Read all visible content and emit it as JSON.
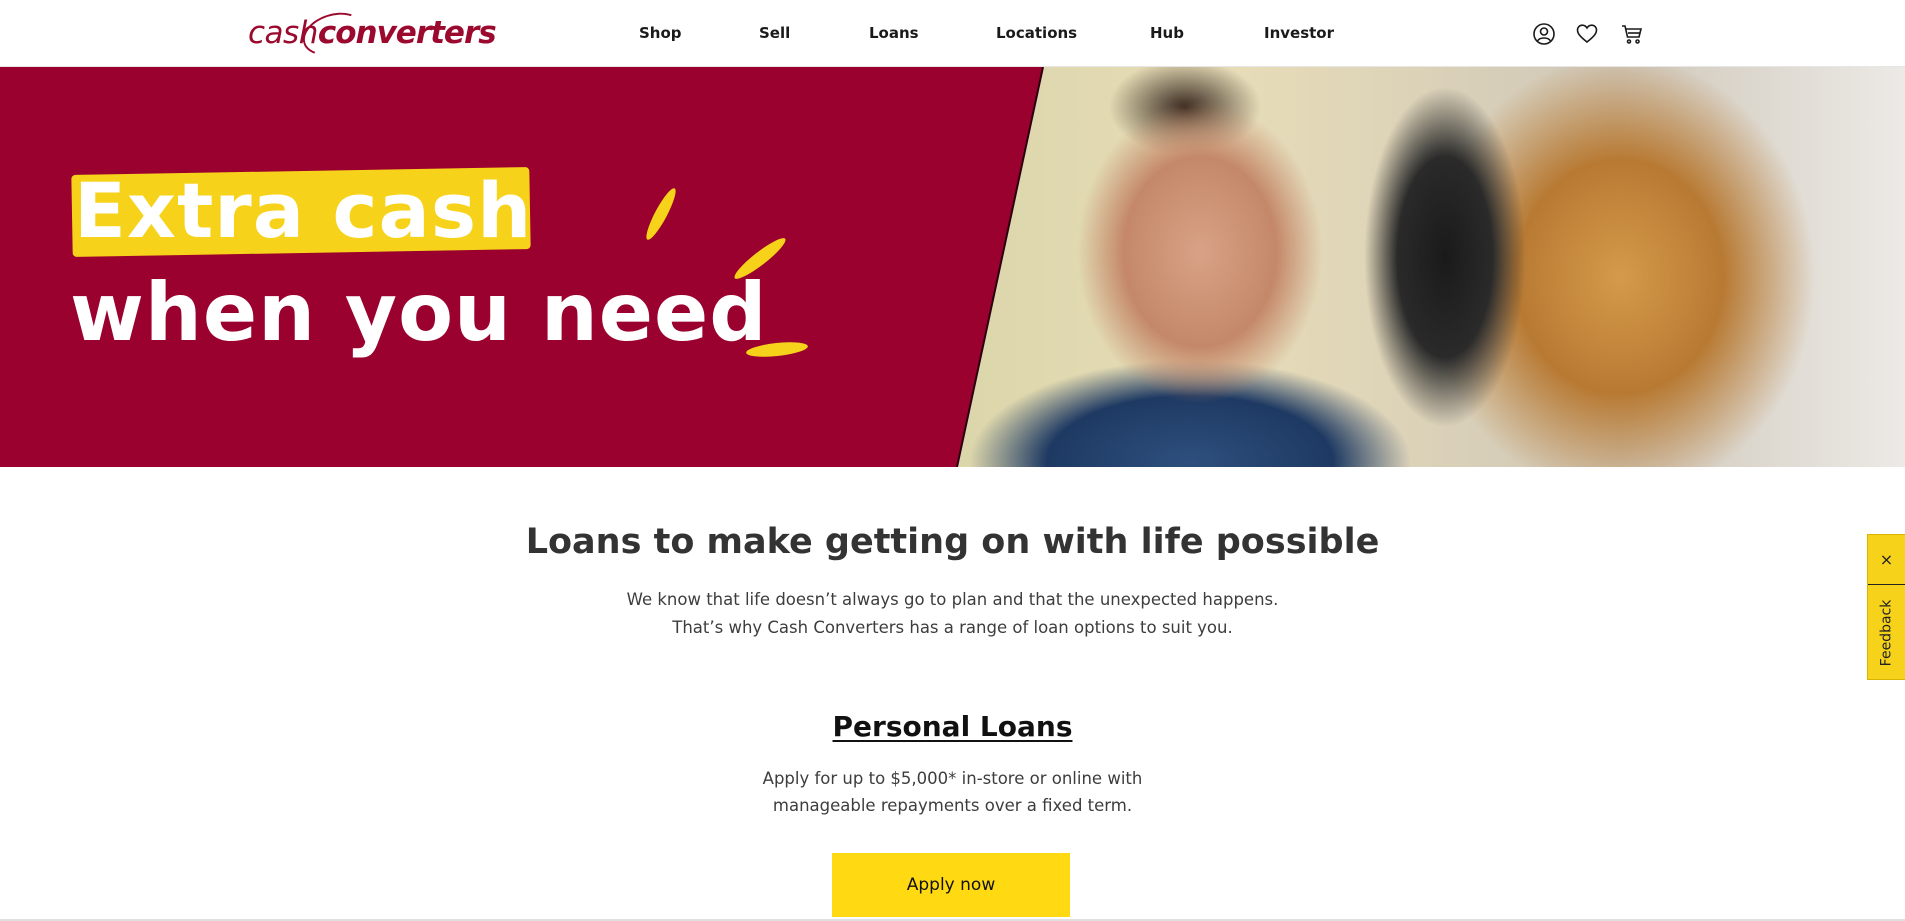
{
  "brand": {
    "logo_part1": "cash",
    "logo_part2": "converters",
    "brand_color": "#9b0a2e",
    "accent_color": "#ffd912"
  },
  "nav": {
    "items": [
      {
        "label": "Shop"
      },
      {
        "label": "Sell"
      },
      {
        "label": "Loans"
      },
      {
        "label": "Locations"
      },
      {
        "label": "Hub"
      },
      {
        "label": "Investor"
      }
    ]
  },
  "header_icons": [
    "account-icon",
    "heart-icon",
    "cart-icon"
  ],
  "hero": {
    "line1": "Extra cash",
    "line2": "when you need",
    "background_color": "#9a012f"
  },
  "intro": {
    "title": "Loans to make getting on with life possible",
    "line1": "We know that life doesn’t always go to plan and that the unexpected happens.",
    "line2": "That’s why Cash Converters has a range of loan options to suit you."
  },
  "personal_loans": {
    "title": "Personal Loans",
    "desc_line1": "Apply for up to $5,000* in-store or online with",
    "desc_line2": "manageable repayments over a fixed term.",
    "button_label": "Apply now"
  },
  "feedback": {
    "close_label": "×",
    "label": "Feedback"
  }
}
